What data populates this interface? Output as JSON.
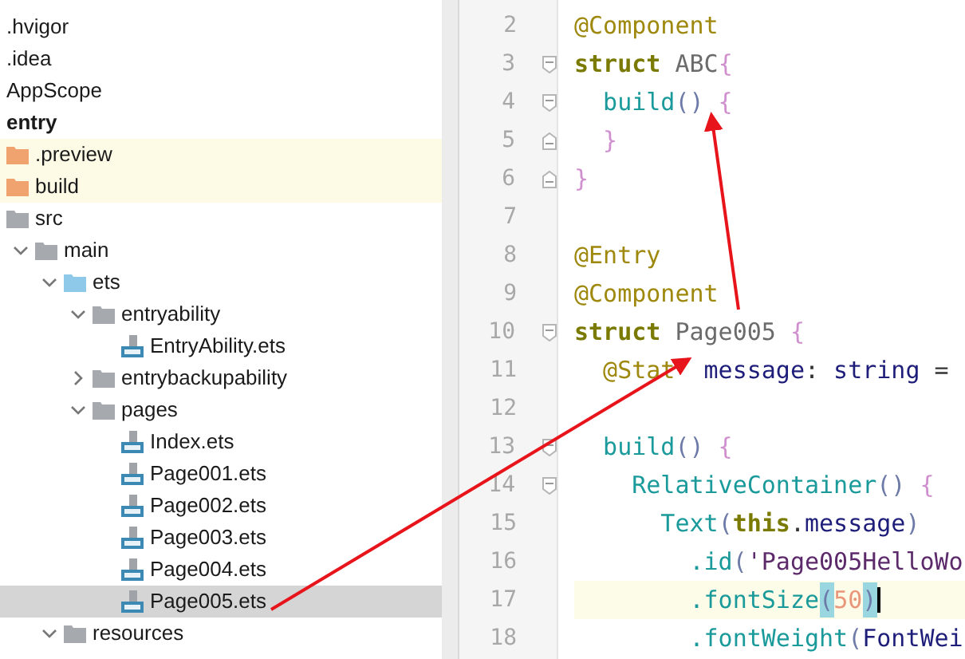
{
  "project_tree": [
    {
      "label": ".hvigor",
      "kind": "plain"
    },
    {
      "label": ".idea",
      "kind": "plain"
    },
    {
      "label": "AppScope",
      "kind": "plain"
    },
    {
      "label": "entry",
      "kind": "module",
      "expanded": true,
      "children": [
        {
          "label": ".preview",
          "kind": "excluded-folder"
        },
        {
          "label": "build",
          "kind": "excluded-folder"
        },
        {
          "label": "src",
          "kind": "folder",
          "expanded": true,
          "children": [
            {
              "label": "main",
              "kind": "folder",
              "expanded": true,
              "children": [
                {
                  "label": "ets",
                  "kind": "source-folder",
                  "expanded": true,
                  "children": [
                    {
                      "label": "entryability",
                      "kind": "folder",
                      "expanded": true,
                      "children": [
                        {
                          "label": "EntryAbility.ets",
                          "kind": "ets-file",
                          "selected": false
                        }
                      ]
                    },
                    {
                      "label": "entrybackupability",
                      "kind": "folder",
                      "expanded": false
                    },
                    {
                      "label": "pages",
                      "kind": "folder",
                      "expanded": true,
                      "children": [
                        {
                          "label": "Index.ets",
                          "kind": "ets-file",
                          "selected": false
                        },
                        {
                          "label": "Page001.ets",
                          "kind": "ets-file",
                          "selected": false
                        },
                        {
                          "label": "Page002.ets",
                          "kind": "ets-file",
                          "selected": false
                        },
                        {
                          "label": "Page003.ets",
                          "kind": "ets-file",
                          "selected": false
                        },
                        {
                          "label": "Page004.ets",
                          "kind": "ets-file",
                          "selected": false
                        },
                        {
                          "label": "Page005.ets",
                          "kind": "ets-file",
                          "selected": true
                        }
                      ]
                    }
                  ]
                },
                {
                  "label": "resources",
                  "kind": "folder",
                  "expanded": true
                }
              ]
            }
          ]
        }
      ]
    }
  ],
  "editor": {
    "lines": [
      {
        "number": "2",
        "tokens": [
          {
            "text": "@Component",
            "kind": "decorator"
          }
        ]
      },
      {
        "number": "3",
        "fold": {
          "kind": "start"
        },
        "tokens": [
          {
            "text": "struct",
            "kind": "keyword"
          },
          {
            "text": " ABC",
            "kind": "name"
          },
          {
            "text": "{",
            "kind": "brace"
          }
        ]
      },
      {
        "number": "4",
        "fold": {
          "kind": "start"
        },
        "tokens": [
          {
            "text": "  build",
            "kind": "function"
          },
          {
            "text": "()",
            "kind": "paren"
          },
          {
            "text": " {",
            "kind": "brace"
          }
        ]
      },
      {
        "number": "5",
        "fold": {
          "kind": "end"
        },
        "tokens": [
          {
            "text": "  }",
            "kind": "brace"
          }
        ]
      },
      {
        "number": "6",
        "fold": {
          "kind": "end"
        },
        "tokens": [
          {
            "text": "}",
            "kind": "brace"
          }
        ]
      },
      {
        "number": "7"
      },
      {
        "number": "8",
        "tokens": [
          {
            "text": "@Entry",
            "kind": "decorator"
          }
        ]
      },
      {
        "number": "9",
        "tokens": [
          {
            "text": "@Component",
            "kind": "decorator"
          }
        ]
      },
      {
        "number": "10",
        "fold": {
          "kind": "start"
        },
        "tokens": [
          {
            "text": "struct",
            "kind": "keyword"
          },
          {
            "text": " Page005",
            "kind": "name"
          },
          {
            "text": " {",
            "kind": "brace"
          }
        ]
      },
      {
        "number": "11",
        "tokens": [
          {
            "text": "  @Stat",
            "kind": "decorator"
          },
          {
            "text": "  message",
            "kind": "field"
          },
          {
            "text": ":",
            "kind": "plain"
          },
          {
            "text": " string",
            "kind": "field"
          },
          {
            "text": " =",
            "kind": "plain"
          }
        ]
      },
      {
        "number": "12"
      },
      {
        "number": "13",
        "fold": {
          "kind": "start"
        },
        "tokens": [
          {
            "text": "  build",
            "kind": "function"
          },
          {
            "text": "()",
            "kind": "paren"
          },
          {
            "text": " {",
            "kind": "brace"
          }
        ]
      },
      {
        "number": "14",
        "fold": {
          "kind": "start"
        },
        "tokens": [
          {
            "text": "    RelativeContainer",
            "kind": "function"
          },
          {
            "text": "()",
            "kind": "paren"
          },
          {
            "text": " {",
            "kind": "brace"
          }
        ]
      },
      {
        "number": "15",
        "tokens": [
          {
            "text": "      Text",
            "kind": "function"
          },
          {
            "text": "(",
            "kind": "paren"
          },
          {
            "text": "this",
            "kind": "keyword"
          },
          {
            "text": ".",
            "kind": "plain"
          },
          {
            "text": "message",
            "kind": "field"
          },
          {
            "text": ")",
            "kind": "paren"
          }
        ]
      },
      {
        "number": "16",
        "tokens": [
          {
            "text": "        .id",
            "kind": "function"
          },
          {
            "text": "(",
            "kind": "paren"
          },
          {
            "text": "'Page005HelloWo",
            "kind": "string"
          }
        ]
      },
      {
        "number": "17",
        "current": true,
        "tokens": [
          {
            "text": "        .fontSize",
            "kind": "function"
          },
          {
            "text": "(",
            "kind": "matched"
          },
          {
            "text": "50",
            "kind": "number"
          },
          {
            "text": ")",
            "kind": "matched"
          }
        ]
      },
      {
        "number": "18",
        "tokens": [
          {
            "text": "        .fontWeight",
            "kind": "function"
          },
          {
            "text": "(",
            "kind": "paren"
          },
          {
            "text": "FontWei",
            "kind": "field"
          }
        ]
      }
    ]
  }
}
